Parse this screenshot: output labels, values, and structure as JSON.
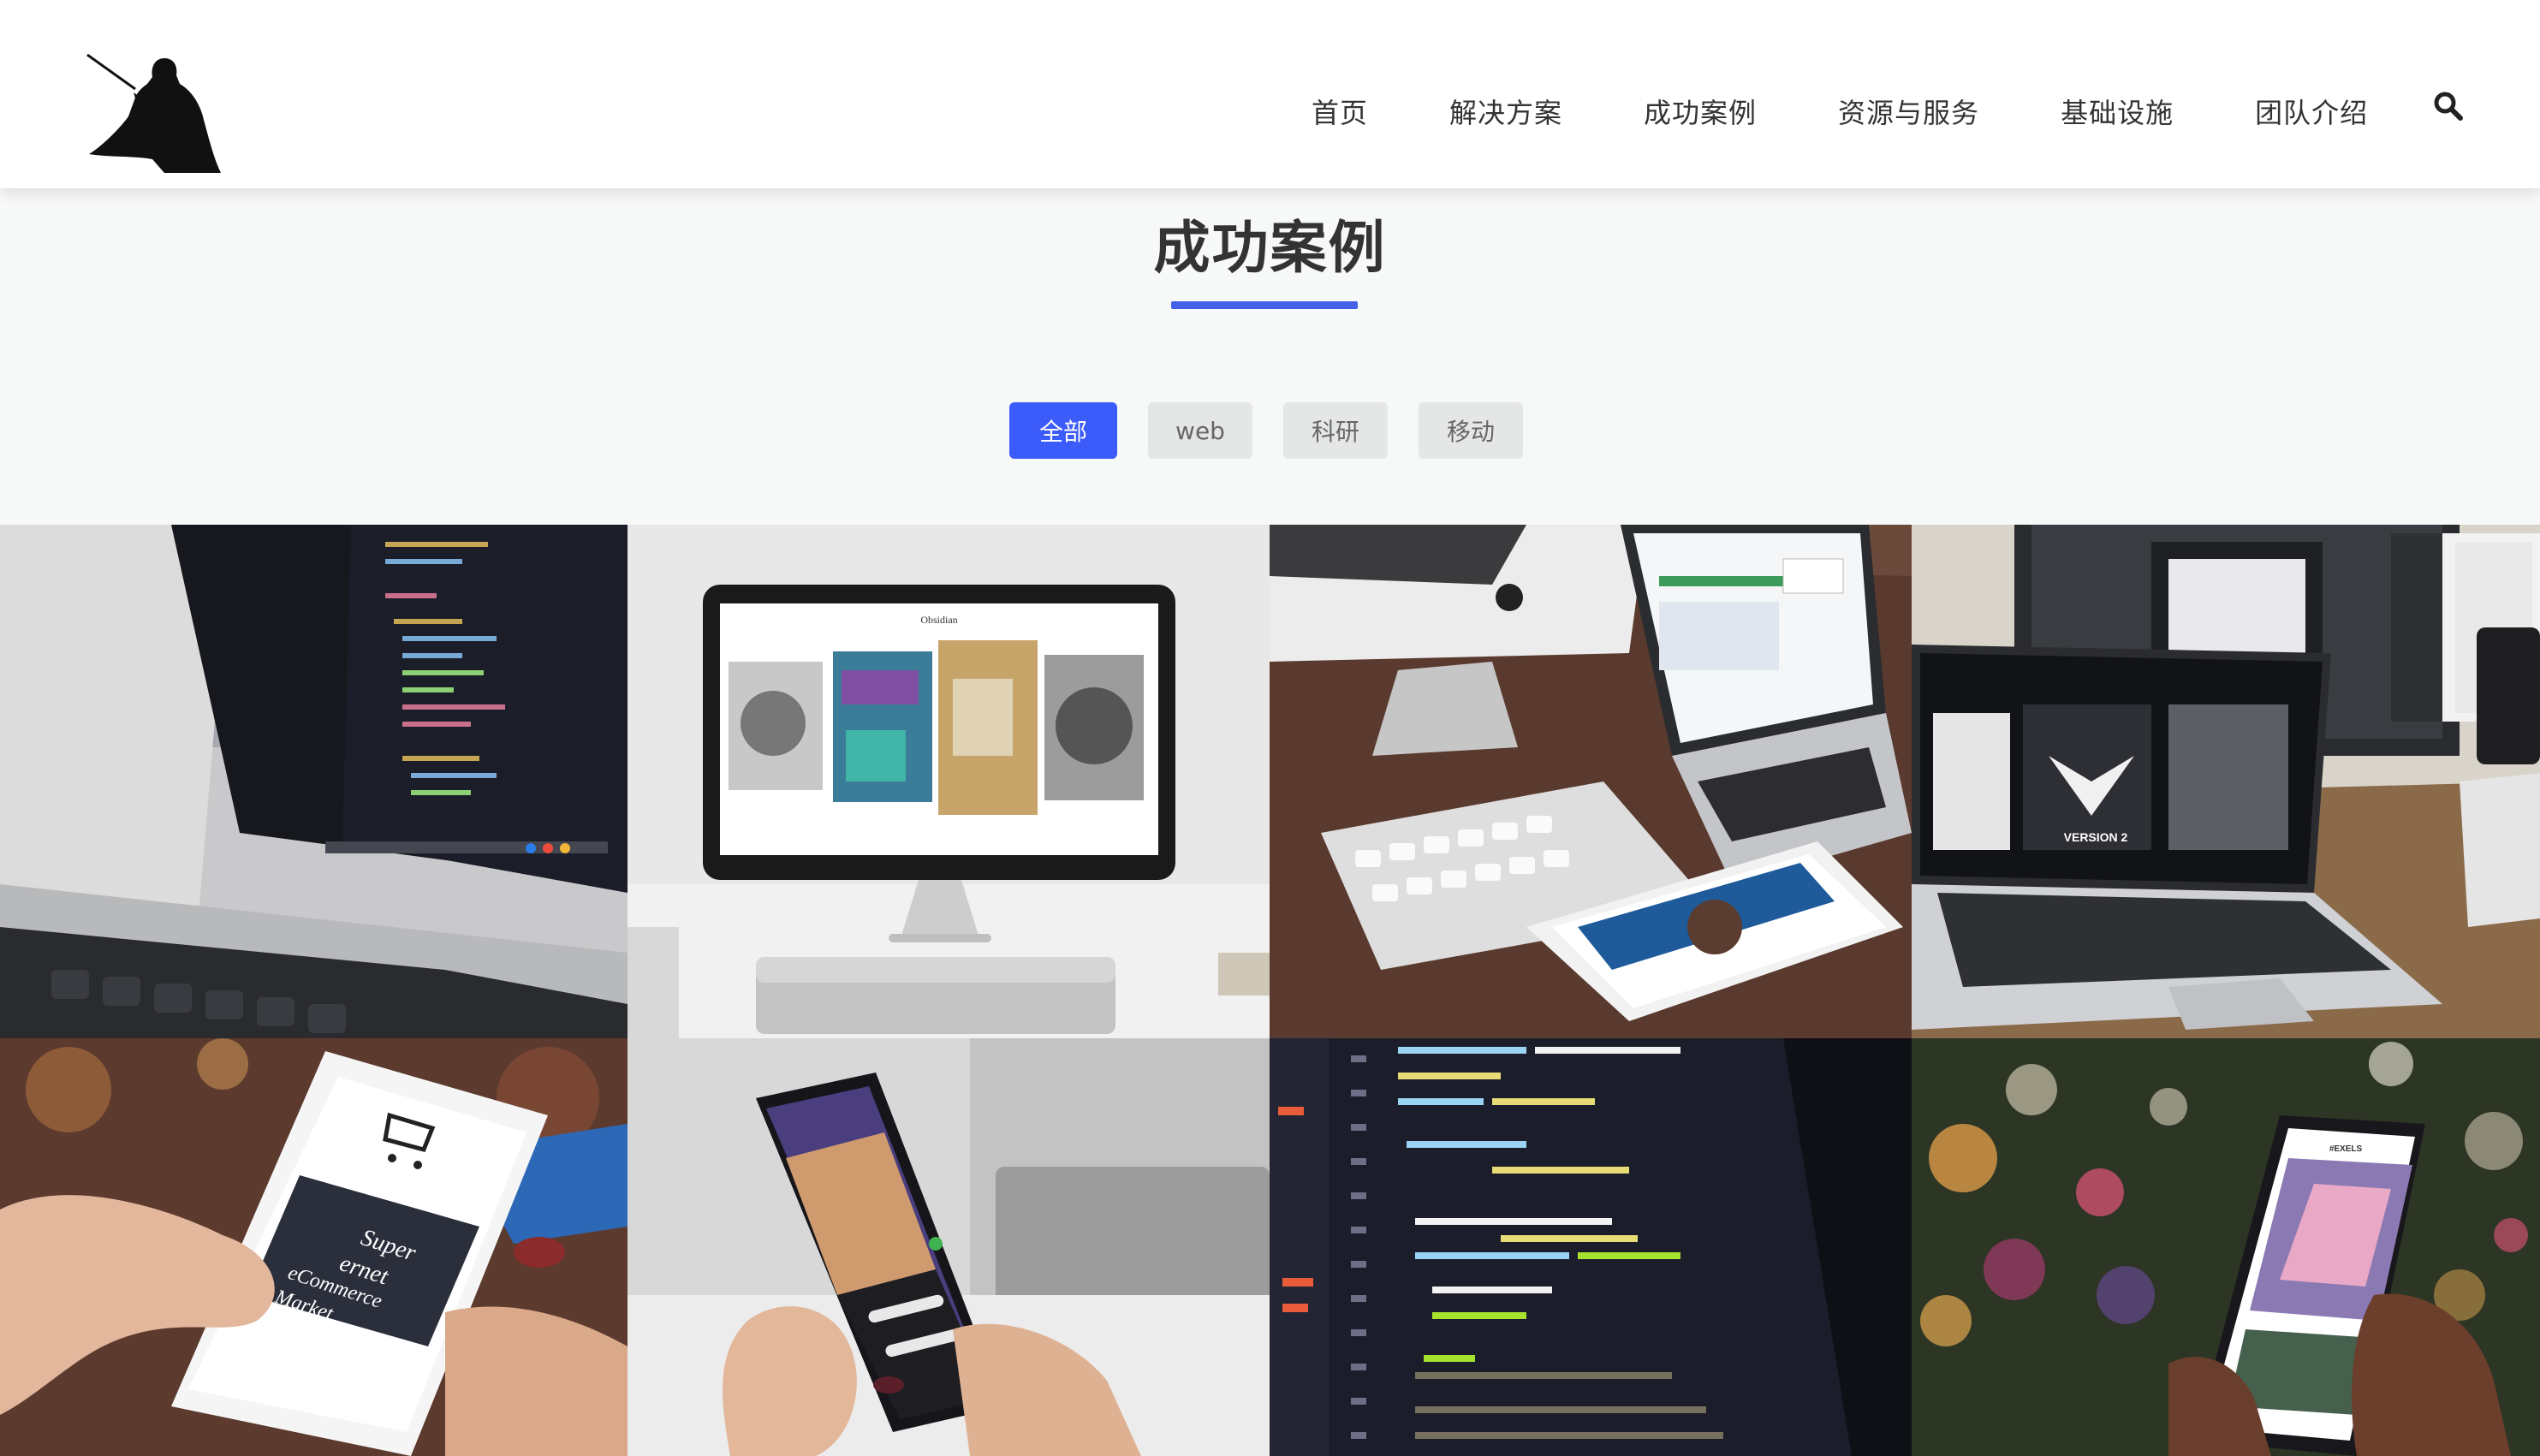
{
  "header": {
    "logo_icon": "darth-vader-silhouette-logo",
    "nav": [
      {
        "label": "首页"
      },
      {
        "label": "解决方案"
      },
      {
        "label": "成功案例"
      },
      {
        "label": "资源与服务"
      },
      {
        "label": "基础设施"
      },
      {
        "label": "团队介绍"
      }
    ],
    "search_icon": "search-icon"
  },
  "section": {
    "title": "成功案例",
    "accent_color": "#4460e6"
  },
  "filters": {
    "items": [
      {
        "label": "全部",
        "active": true
      },
      {
        "label": "web",
        "active": false
      },
      {
        "label": "科研",
        "active": false
      },
      {
        "label": "移动",
        "active": false
      }
    ],
    "active_color": "#3b5bfb",
    "inactive_color": "#e5e6e6"
  },
  "portfolio": {
    "items": [
      {
        "image": "laptop-with-code-editor"
      },
      {
        "image": "imac-with-gallery-website"
      },
      {
        "image": "imac-laptop-tablet-on-wood-desk"
      },
      {
        "image": "laptop-with-design-website"
      },
      {
        "image": "phone-ecommerce-app-in-hand"
      },
      {
        "image": "iphone-weather-app-in-hands"
      },
      {
        "image": "monitor-with-ruby-code"
      },
      {
        "image": "iphone-photo-app-bokeh-background"
      }
    ],
    "screen_texts": {
      "gallery_site_title": "Obsidian",
      "ecommerce_line1": "Super",
      "ecommerce_line2": "ernet",
      "ecommerce_line3": "eCommerce",
      "ecommerce_line4": "Market",
      "design_site_badge": "VERSION 2",
      "photo_app_title": "#EXELS"
    }
  }
}
